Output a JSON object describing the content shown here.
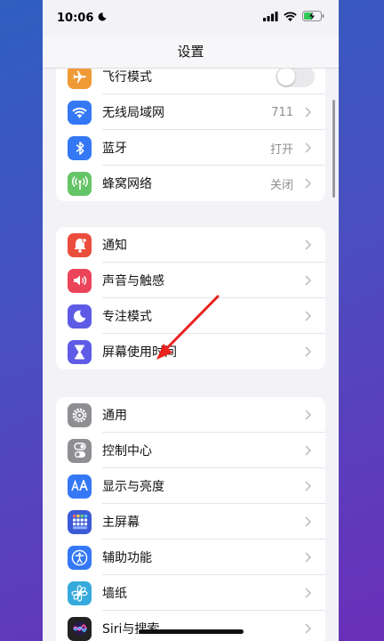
{
  "status_bar": {
    "time": "10:06"
  },
  "nav": {
    "title": "设置"
  },
  "groups": [
    {
      "items": [
        {
          "label": "飞行模式",
          "icon": "airplane-icon",
          "color": "#f09a37",
          "control": "toggle",
          "toggle_on": false
        },
        {
          "label": "无线局域网",
          "icon": "wifi-icon",
          "color": "#3478f6",
          "value": "711"
        },
        {
          "label": "蓝牙",
          "icon": "bluetooth-icon",
          "color": "#3478f6",
          "value": "打开"
        },
        {
          "label": "蜂窝网络",
          "icon": "antenna-icon",
          "color": "#65c466",
          "value": "关闭"
        }
      ]
    },
    {
      "items": [
        {
          "label": "通知",
          "icon": "bell-icon",
          "color": "#eb4d3d"
        },
        {
          "label": "声音与触感",
          "icon": "speaker-icon",
          "color": "#eb445a"
        },
        {
          "label": "专注模式",
          "icon": "moon-icon",
          "color": "#5e5ce6"
        },
        {
          "label": "屏幕使用时间",
          "icon": "hourglass-icon",
          "color": "#5e5ce6"
        }
      ]
    },
    {
      "items": [
        {
          "label": "通用",
          "icon": "gear-icon",
          "color": "#8e8e93"
        },
        {
          "label": "控制中心",
          "icon": "switches-icon",
          "color": "#8e8e93"
        },
        {
          "label": "显示与亮度",
          "icon": "text-size-icon",
          "color": "#3478f6"
        },
        {
          "label": "主屏幕",
          "icon": "home-grid-icon",
          "color": "#3b5bd6"
        },
        {
          "label": "辅助功能",
          "icon": "accessibility-icon",
          "color": "#3478f6"
        },
        {
          "label": "墙纸",
          "icon": "flower-icon",
          "color": "#36aadc"
        },
        {
          "label": "Siri与搜索",
          "icon": "siri-icon",
          "color": "#222222"
        }
      ]
    }
  ],
  "annotation": {
    "arrow_color": "#e8231f"
  }
}
